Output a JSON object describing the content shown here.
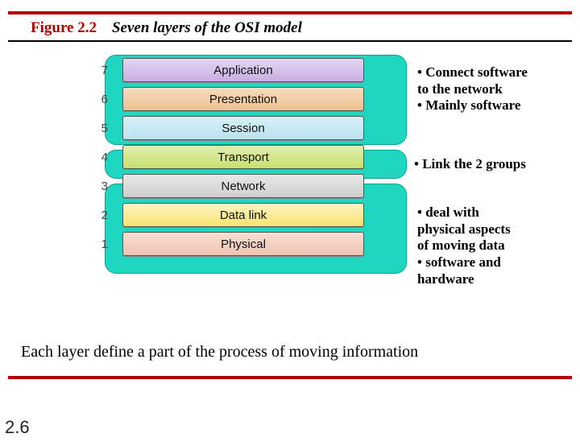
{
  "figure": {
    "label": "Figure 2.2",
    "caption": "Seven layers of the OSI model"
  },
  "layers": [
    {
      "n": "7",
      "name": "Application",
      "cls": "c-purple"
    },
    {
      "n": "6",
      "name": "Presentation",
      "cls": "c-orange"
    },
    {
      "n": "5",
      "name": "Session",
      "cls": "c-cyan"
    },
    {
      "n": "4",
      "name": "Transport",
      "cls": "c-green"
    },
    {
      "n": "3",
      "name": "Network",
      "cls": "c-gray"
    },
    {
      "n": "2",
      "name": "Data link",
      "cls": "c-yellow"
    },
    {
      "n": "1",
      "name": "Physical",
      "cls": "c-pink"
    }
  ],
  "notes": {
    "top": {
      "l1": "•  Connect software",
      "l2": "to the network",
      "l3": "• Mainly software"
    },
    "mid": {
      "l1": "•  Link the 2 groups"
    },
    "bot": {
      "l1": "•  deal with",
      "l2": "physical aspects",
      "l3": "of moving data",
      "l4": "• software and",
      "l5": "hardware"
    }
  },
  "summary": "Each layer define a part of the process of moving information",
  "page": "2.6"
}
